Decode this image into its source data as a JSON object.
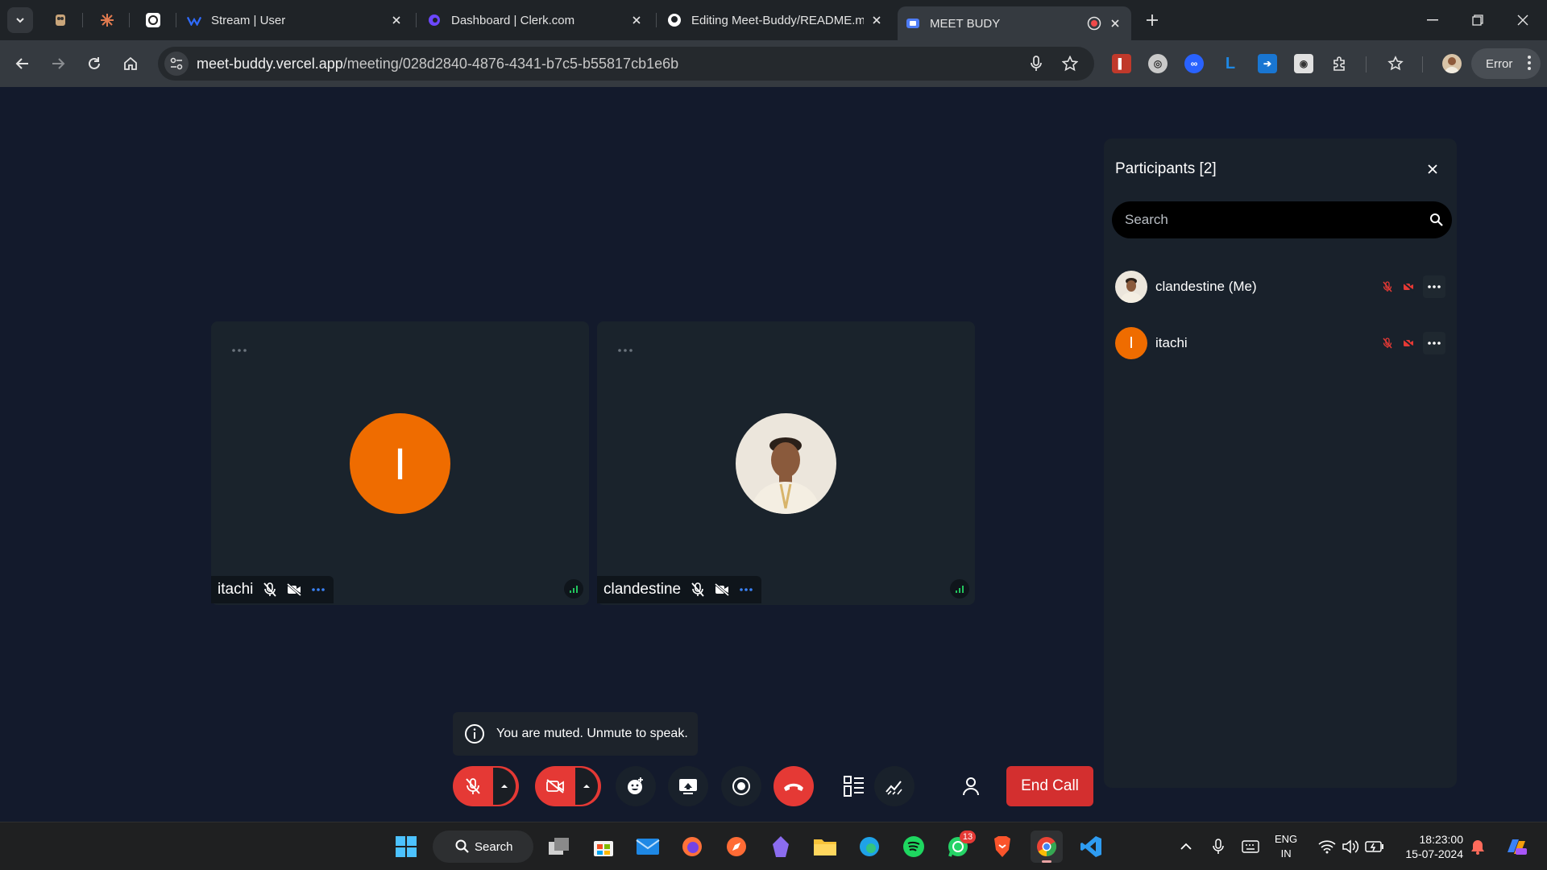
{
  "browser": {
    "tabs": [
      {
        "title": "Stream | User",
        "favicon": "stream-icon"
      },
      {
        "title": "Dashboard | Clerk.com",
        "favicon": "clerk-icon"
      },
      {
        "title": "Editing Meet-Buddy/README.m",
        "favicon": "github-icon"
      },
      {
        "title": "MEET BUDY",
        "favicon": "meet-budy-icon",
        "active": true
      }
    ],
    "url_host": "meet-buddy.vercel.app",
    "url_path": "/meeting/028d2840-4876-4341-b7c5-b55817cb1e6b",
    "profile_button": "Error"
  },
  "meeting": {
    "participants_tiles": [
      {
        "name": "itachi",
        "initial": "I",
        "avatar_color": "#ef6c00"
      },
      {
        "name": "clandestine",
        "initial": "",
        "avatar": "photo"
      }
    ],
    "toast": "You are muted. Unmute to speak.",
    "end_call": "End Call"
  },
  "panel": {
    "title": "Participants [2]",
    "search_placeholder": "Search",
    "list": [
      {
        "name": "clandestine (Me)",
        "avatar": "photo"
      },
      {
        "name": "itachi",
        "initial": "I",
        "avatar_color": "#ef6c00"
      }
    ]
  },
  "taskbar": {
    "search_label": "Search",
    "whatsapp_badge": "13",
    "lang_line1": "ENG",
    "lang_line2": "IN",
    "time": "18:23:00",
    "date": "15-07-2024"
  },
  "colors": {
    "accent_red": "#e53935",
    "end_call": "#d32f2f",
    "bg": "#131a2c",
    "tile": "#1a232c"
  }
}
